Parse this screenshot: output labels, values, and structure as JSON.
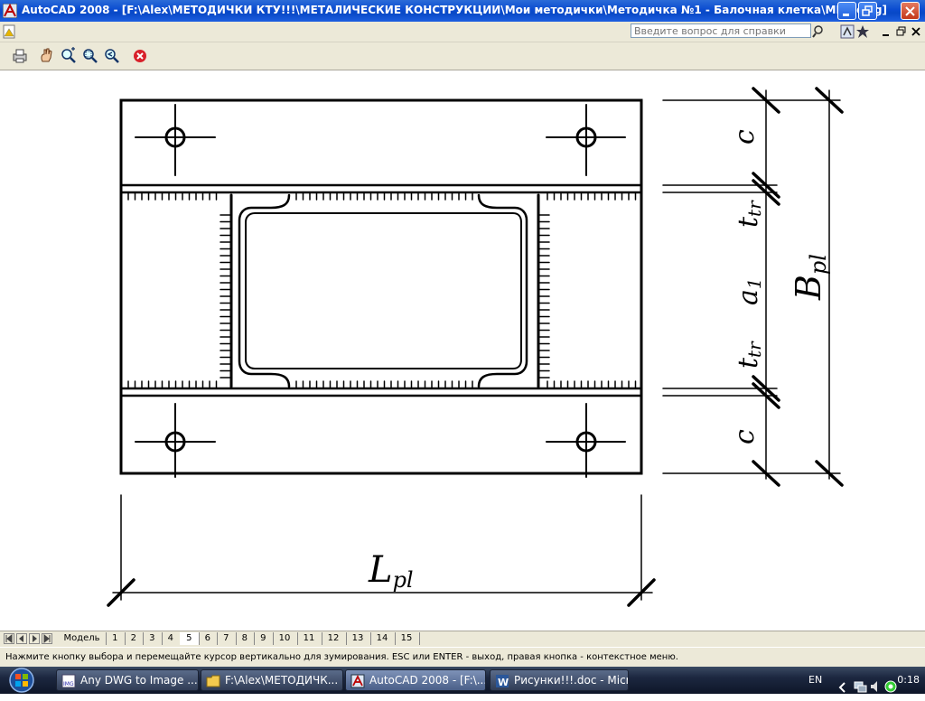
{
  "window": {
    "title": "AutoCAD 2008 - [F:\\Alex\\МЕТОДИЧКИ КТУ!!!\\МЕТАЛИЧЕСКИЕ КОНСТРУКЦИИ\\Мои методички\\Методичка №1 - Балочная клетка\\МК2.dwg]",
    "controls": [
      "minimize-icon",
      "restore-icon",
      "close-icon"
    ]
  },
  "menubar": {
    "help_placeholder": "Введите вопрос для справки",
    "icons": [
      "search-icon",
      "comm-center-icon",
      "favorites-icon",
      "doc-minimize-icon",
      "doc-restore-icon",
      "doc-close-icon"
    ]
  },
  "toolbar": {
    "buttons": [
      "print-icon",
      "pan-icon",
      "zoom-realtime-icon",
      "zoom-window-icon",
      "zoom-previous-icon",
      "close-preview-icon"
    ]
  },
  "drawing": {
    "labels": {
      "c_top": "c",
      "ttr_top": "t",
      "ttr_top_sub": "tr",
      "a1": "a",
      "a1_sub": "1",
      "ttr_bottom": "t",
      "ttr_bottom_sub": "tr",
      "c_bottom": "c",
      "B": "B",
      "B_sub": "pl",
      "L": "L",
      "L_sub": "pl"
    }
  },
  "layout_tabs": {
    "tabs": [
      "Модель",
      "1",
      "2",
      "3",
      "4",
      "5",
      "6",
      "7",
      "8",
      "9",
      "10",
      "11",
      "12",
      "13",
      "14",
      "15"
    ],
    "active": "5"
  },
  "status": {
    "prompt": "Нажмите кнопку выбора и перемещайте курсор вертикально для зумирования. ESC или ENTER - выход, правая кнопка - контекстное меню."
  },
  "taskbar": {
    "items": [
      {
        "label": "Any DWG to Image ...",
        "icon": "dwg-converter-icon"
      },
      {
        "label": "F:\\Alex\\МЕТОДИЧК...",
        "icon": "folder-icon"
      },
      {
        "label": "AutoCAD 2008 - [F:\\...",
        "icon": "autocad-icon"
      },
      {
        "label": "Рисунки!!!.doc - Micr...",
        "icon": "word-icon"
      }
    ],
    "active": "AutoCAD 2008 - [F:\\...",
    "language": "EN",
    "clock": "0:18"
  }
}
